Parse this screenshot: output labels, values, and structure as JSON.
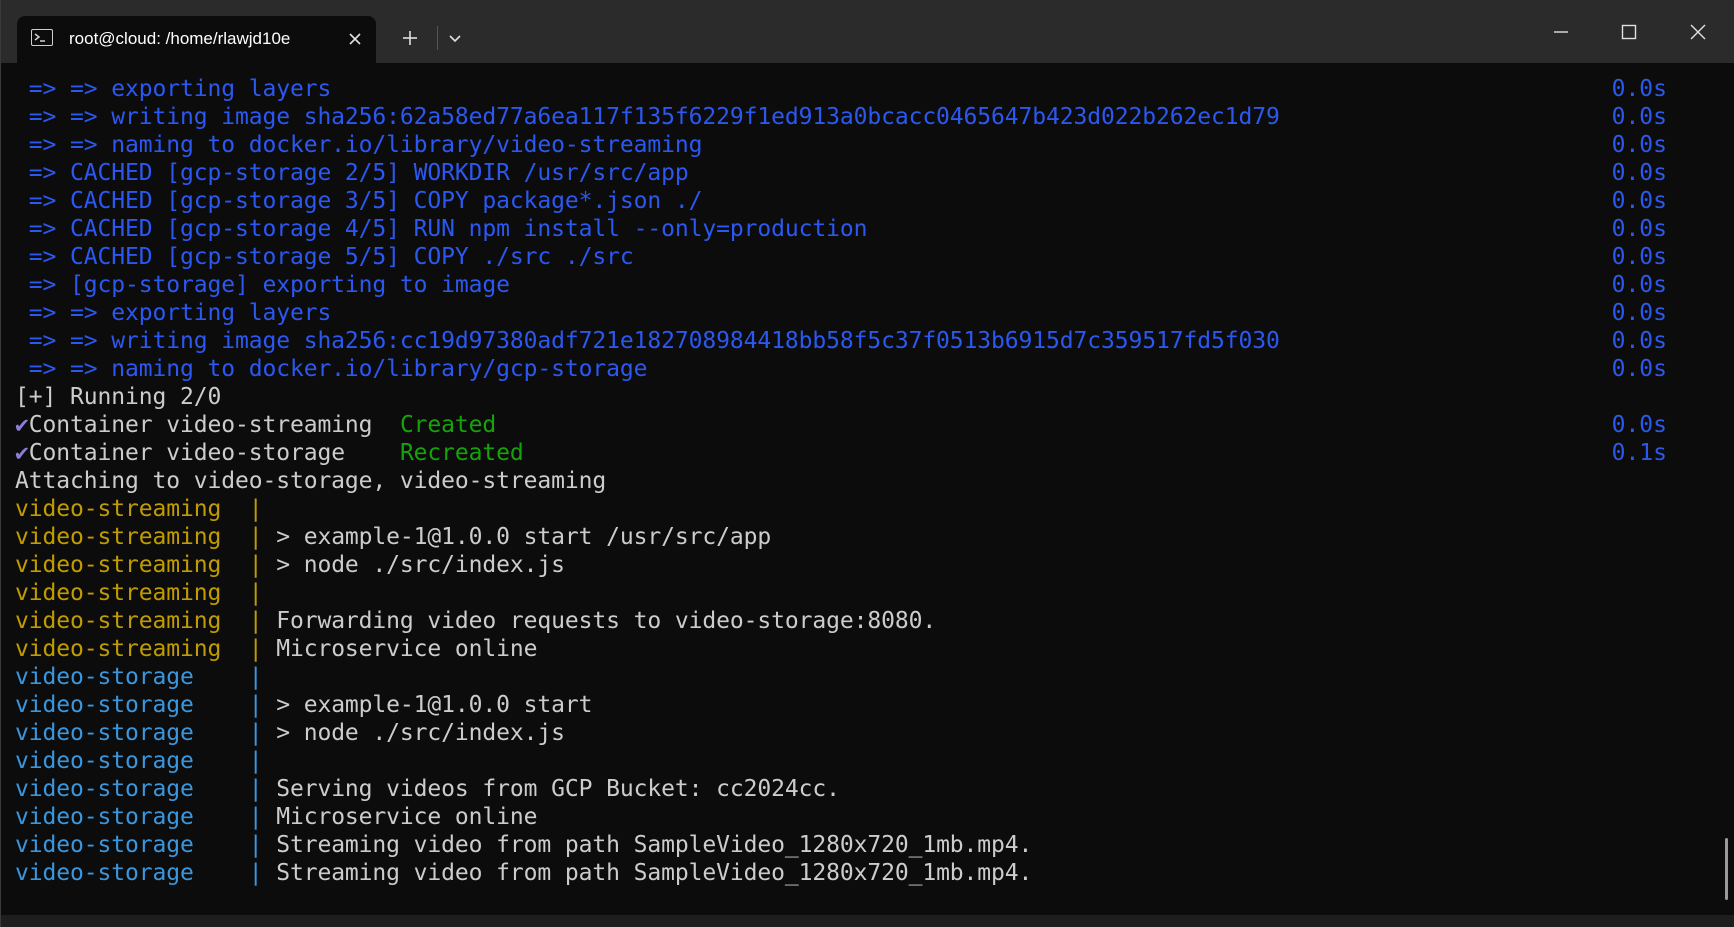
{
  "window": {
    "tab_title": "root@cloud: /home/rlawjd10e",
    "tab_icon": "terminal-icon",
    "controls": [
      "minimize-icon",
      "maximize-icon",
      "close-icon"
    ]
  },
  "colors": {
    "background": "#0c0c0c",
    "titlebar": "#2b2b2b",
    "build_blue": "#2b58f0",
    "created_green": "#16a30a",
    "streaming_yellow": "#c19c00",
    "storage_cyan": "#3a96dd",
    "text_default": "#cccccc"
  },
  "build_lines": [
    {
      "text": " => => exporting layers",
      "time": "0.0s"
    },
    {
      "text": " => => writing image sha256:62a58ed77a6ea117f135f6229f1ed913a0bcacc0465647b423d022b262ec1d79",
      "time": "0.0s"
    },
    {
      "text": " => => naming to docker.io/library/video-streaming",
      "time": "0.0s"
    },
    {
      "text": " => CACHED [gcp-storage 2/5] WORKDIR /usr/src/app",
      "time": "0.0s"
    },
    {
      "text": " => CACHED [gcp-storage 3/5] COPY package*.json ./",
      "time": "0.0s"
    },
    {
      "text": " => CACHED [gcp-storage 4/5] RUN npm install --only=production",
      "time": "0.0s"
    },
    {
      "text": " => CACHED [gcp-storage 5/5] COPY ./src ./src",
      "time": "0.0s"
    },
    {
      "text": " => [gcp-storage] exporting to image",
      "time": "0.0s"
    },
    {
      "text": " => => exporting layers",
      "time": "0.0s"
    },
    {
      "text": " => => writing image sha256:cc19d97380adf721e182708984418bb58f5c37f0513b6915d7c359517fd5f030",
      "time": "0.0s"
    },
    {
      "text": " => => naming to docker.io/library/gcp-storage",
      "time": "0.0s"
    }
  ],
  "running_line": "[+] Running 2/0",
  "containers": [
    {
      "check": "✔",
      "name": "Container video-streaming  ",
      "status": "Created",
      "time": "0.0s"
    },
    {
      "check": "✔",
      "name": "Container video-storage    ",
      "status": "Recreated",
      "time": "0.1s"
    }
  ],
  "attaching_line": "Attaching to video-storage, video-streaming",
  "log_lines": [
    {
      "service": "video-streaming  ",
      "sep": "|",
      "msg": ""
    },
    {
      "service": "video-streaming  ",
      "sep": "|",
      "msg": " > example-1@1.0.0 start /usr/src/app"
    },
    {
      "service": "video-streaming  ",
      "sep": "|",
      "msg": " > node ./src/index.js"
    },
    {
      "service": "video-streaming  ",
      "sep": "|",
      "msg": ""
    },
    {
      "service": "video-streaming  ",
      "sep": "|",
      "msg": " Forwarding video requests to video-storage:8080."
    },
    {
      "service": "video-streaming  ",
      "sep": "|",
      "msg": " Microservice online"
    },
    {
      "service": "video-storage    ",
      "sep": "|",
      "msg": ""
    },
    {
      "service": "video-storage    ",
      "sep": "|",
      "msg": " > example-1@1.0.0 start"
    },
    {
      "service": "video-storage    ",
      "sep": "|",
      "msg": " > node ./src/index.js"
    },
    {
      "service": "video-storage    ",
      "sep": "|",
      "msg": ""
    },
    {
      "service": "video-storage    ",
      "sep": "|",
      "msg": " Serving videos from GCP Bucket: cc2024cc."
    },
    {
      "service": "video-storage    ",
      "sep": "|",
      "msg": " Microservice online"
    },
    {
      "service": "video-storage    ",
      "sep": "|",
      "msg": " Streaming video from path SampleVideo_1280x720_1mb.mp4."
    },
    {
      "service": "video-storage    ",
      "sep": "|",
      "msg": " Streaming video from path SampleVideo_1280x720_1mb.mp4."
    }
  ]
}
